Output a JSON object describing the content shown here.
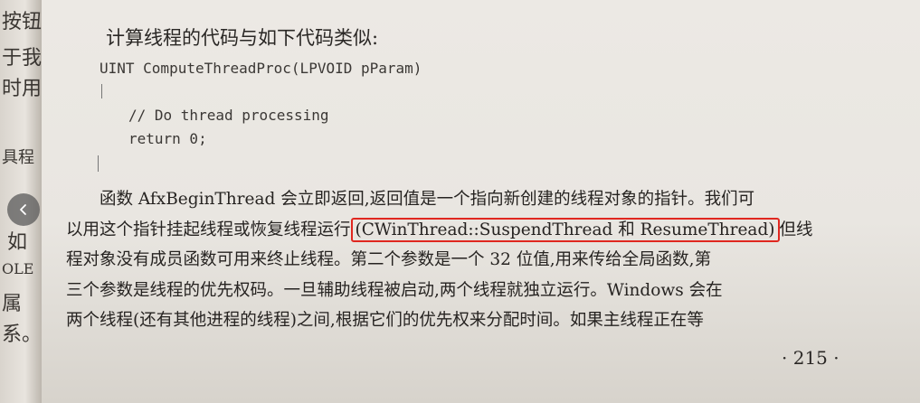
{
  "left_page_fragments": [
    "按钮",
    "于我",
    "时用",
    "具程",
    "如",
    "OLE",
    "属",
    "系。"
  ],
  "heading": "计算线程的代码与如下代码类似:",
  "code": {
    "line1": "UINT ComputeThreadProc(LPVOID pParam)",
    "line2": "// Do thread processing",
    "line3": "return 0;"
  },
  "paragraph": {
    "line1": "函数 AfxBeginThread 会立即返回,返回值是一个指向新创建的线程对象的指针。我们可",
    "line2_before": "以用这个指针挂起线程或恢复线程运行",
    "line2_highlight": "(CWinThread::SuspendThread 和 ResumeThread)",
    "line2_after": "但线",
    "line3": "程对象没有成员函数可用来终止线程。第二个参数是一个 32 位值,用来传给全局函数,第",
    "line4": "三个参数是线程的优先权码。一旦辅助线程被启动,两个线程就独立运行。Windows 会在",
    "line5": "两个线程(还有其他进程的线程)之间,根据它们的优先权来分配时间。如果主线程正在等"
  },
  "page_number": "· 215 ·",
  "highlight_color": "#e0271f",
  "nav_icon": "chevron-left-icon"
}
